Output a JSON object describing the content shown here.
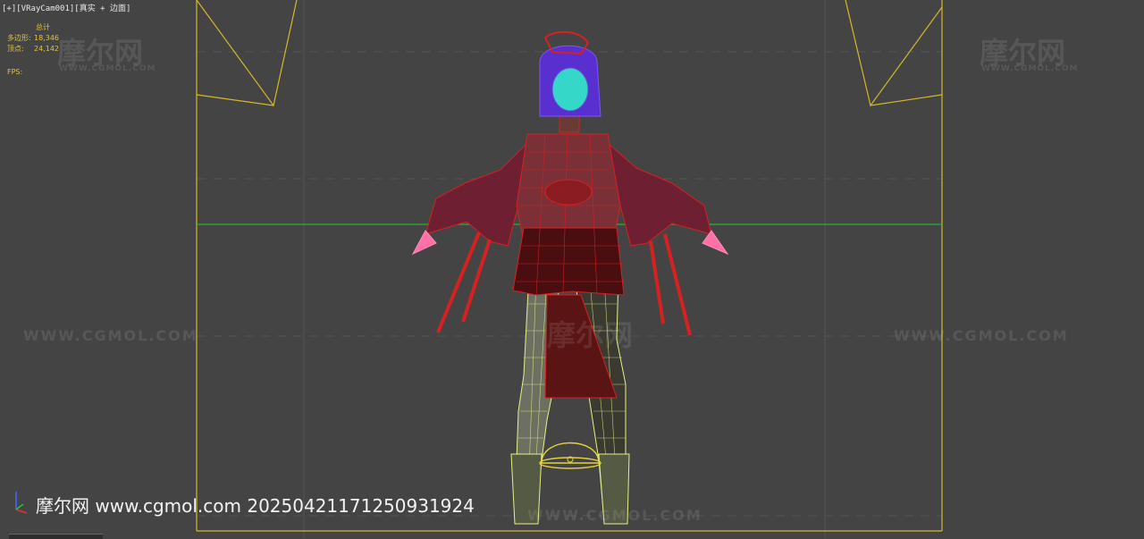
{
  "viewport": {
    "label_plus": "[+]",
    "label_camera": "[VRayCam001]",
    "label_mode": "[真实 + 边面]"
  },
  "stats": {
    "header": "总计",
    "polys_label": "多边形:",
    "polys_value": "18,346",
    "verts_label": "顶点:",
    "verts_value": "24,142",
    "fps_label": "FPS:"
  },
  "watermarks": {
    "logo": "摩尔网",
    "logo_sub": "WWW.CGMOL.COM",
    "url": "WWW.CGMOL.COM"
  },
  "caption": "摩尔网 www.cgmol.com 20250421171250931924",
  "colors": {
    "background": "#444444",
    "safe_frame": "#d6b826",
    "horizon": "#2bb52b",
    "wire_red": "#d82020",
    "wire_yellow": "#e6f08a",
    "hair": "#5a2fd0",
    "face": "#35d7c8"
  }
}
